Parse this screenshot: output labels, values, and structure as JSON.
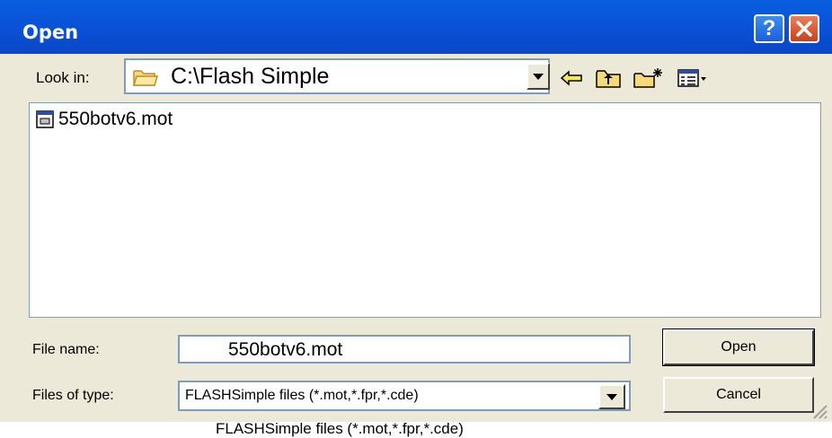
{
  "window": {
    "title": "Open",
    "help_label": "?"
  },
  "lookin": {
    "label": "Look in:",
    "value": "C:\\Flash  Simple",
    "folder_icon": "folder-icon",
    "tools": [
      "back-arrow-icon",
      "up-one-level-icon",
      "new-folder-icon",
      "view-menu-icon"
    ]
  },
  "files": [
    {
      "name": "550botv6.mot",
      "icon": "file-icon"
    }
  ],
  "filename": {
    "label": "File name:",
    "value": "550botv6.mot"
  },
  "filetype": {
    "label": "Files of type:",
    "value": "FLASHSimple files (*.mot,*.fpr,*.cde)"
  },
  "buttons": {
    "open_label": "Open",
    "cancel_label": "Cancel"
  },
  "ghost_text": "FLASHSimple files (*.mot,*.fpr,*.cde)",
  "colors": {
    "titlebar": "#0a53d8",
    "dialog_bg": "#ece9d8",
    "field_border": "#7f9db9"
  }
}
